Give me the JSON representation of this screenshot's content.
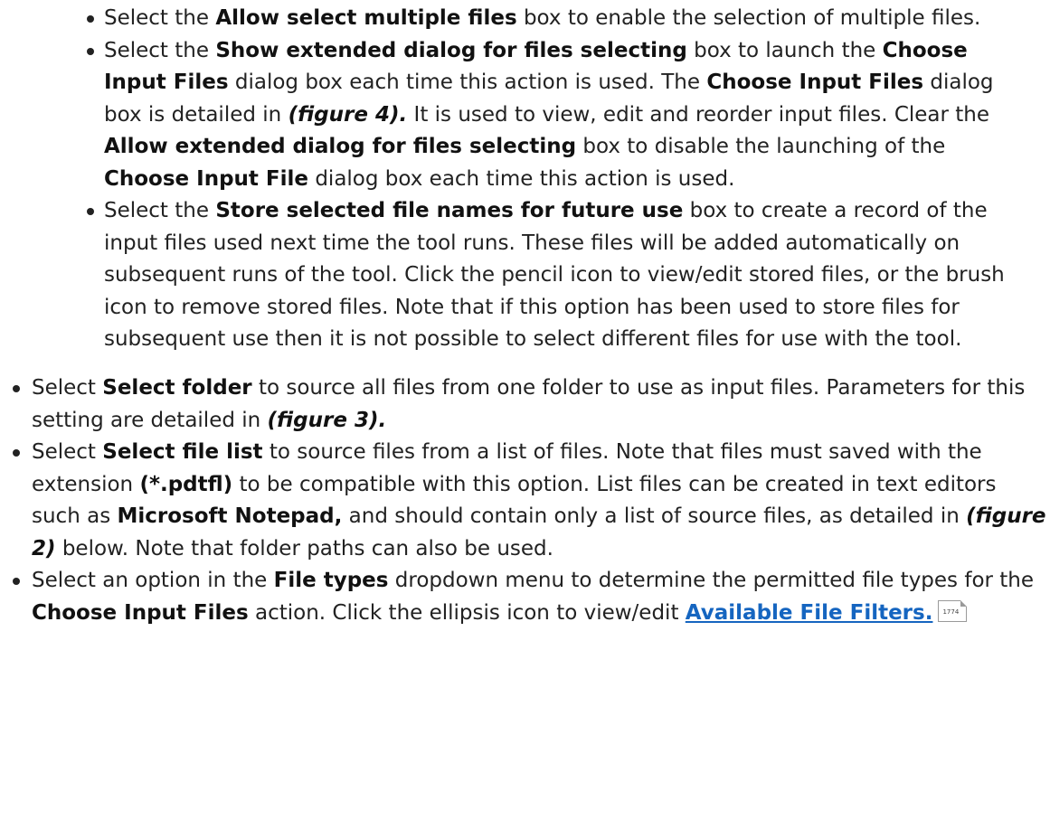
{
  "inner_list": [
    {
      "t1": "Select the ",
      "b1": "Allow select multiple files",
      "t2": " box to enable the selection of multiple files."
    },
    {
      "t1": "Select the ",
      "b1": "Show extended dialog for files selecting",
      "t2": " box to launch the ",
      "b2": "Choose Input Files",
      "t3": " dialog box each time this action is used. The ",
      "b3": "Choose Input Files",
      "t4": " dialog box is detailed in ",
      "fig": "(figure 4).",
      "t5": " It is used to view, edit and reorder input files. Clear the ",
      "b4": "Allow extended dialog for files selecting",
      "t6": " box to disable the launching of the ",
      "b5": "Choose Input File",
      "t7": " dialog box each time this action is used."
    },
    {
      "t1": "Select the ",
      "b1": "Store selected file names for future use",
      "t2": " box to create a record of the input files used next time the tool runs. These files will be added automatically on subsequent runs of the tool. Click the pencil icon to view/edit stored files, or the brush icon to remove stored files. Note that if this option has been used to store files for subsequent use then it is not possible to select different files for use with the tool."
    }
  ],
  "outer_list": [
    {
      "t1": "Select ",
      "b1": "Select folder",
      "t2": " to source all files from one folder to use as input files. Parameters for this setting are detailed in ",
      "fig": "(figure 3)."
    },
    {
      "t1": "Select ",
      "b1": "Select file list",
      "t2": " to source files from a list of files. Note that files must saved with the extension ",
      "b2": "(*.pdtfl)",
      "t3": " to be compatible with this option. List files can be created in text editors such as ",
      "b3": "Microsoft Notepad,",
      "t4": " and should contain only a list of source files, as detailed in ",
      "fig": "(figure 2)",
      "t5": " below. Note that folder paths can also be used."
    },
    {
      "t1": "Select an option in the ",
      "b1": "File types",
      "t2": " dropdown menu to determine the permitted file types for the ",
      "b2": "Choose Input Files",
      "t3": " action. Click the ellipsis icon to view/edit ",
      "link": "Available File Filters.",
      "page_ref": "1774"
    }
  ]
}
